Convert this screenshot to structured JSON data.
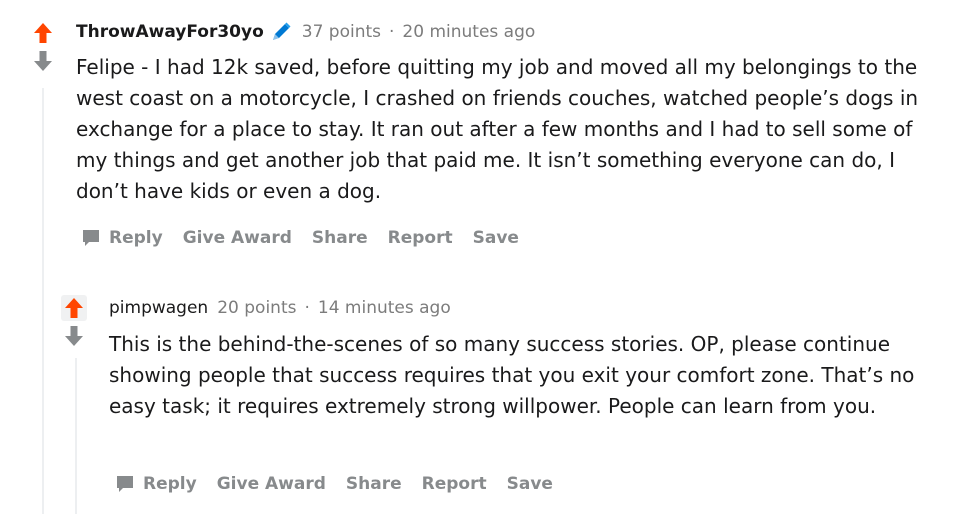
{
  "comments": [
    {
      "author": "ThrowAwayFor30yo",
      "points": "37 points",
      "dot": "·",
      "time": "20 minutes ago",
      "body": "Felipe - I had 12k saved, before quitting my job and moved all my belongings to the west coast on a motorcycle, I crashed on friends couches, watched people’s dogs in exchange for a place to stay. It ran out after a few months and I had to sell some of my things and get another job that paid me. It isn’t something everyone can do, I don’t have kids or even a dog.",
      "actions": {
        "reply": "Reply",
        "award": "Give Award",
        "share": "Share",
        "report": "Report",
        "save": "Save"
      }
    },
    {
      "author": "pimpwagen",
      "points": "20 points",
      "dot": "·",
      "time": "14 minutes ago",
      "body": "This is the behind-the-scenes of so many success stories. OP, please continue showing people that success requires that you exit your comfort zone. That’s no easy task; it requires extremely strong willpower. People can learn from you.",
      "actions": {
        "reply": "Reply",
        "award": "Give Award",
        "share": "Share",
        "report": "Report",
        "save": "Save"
      }
    }
  ],
  "colors": {
    "upvote": "#ff4500",
    "downvote": "#878a8c",
    "flair": "#0079d3",
    "thread": "#edeff1"
  },
  "icons": {
    "upvote": "upvote-arrow-icon",
    "downvote": "downvote-arrow-icon",
    "flair": "pencil-icon",
    "reply": "speech-bubble-icon"
  }
}
